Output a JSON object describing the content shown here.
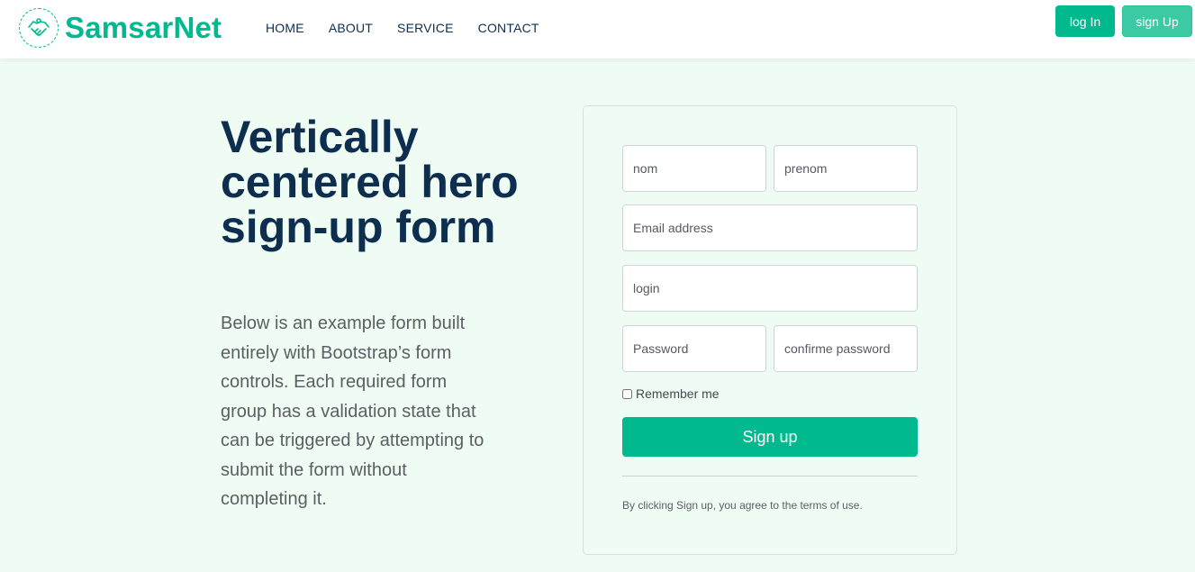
{
  "brand": {
    "name": "SamsarNet",
    "logo_icon": "handshake-icon",
    "accent_color": "#00b98e"
  },
  "nav": {
    "links": [
      {
        "label": "HOME"
      },
      {
        "label": "ABOUT"
      },
      {
        "label": "SERVICE"
      },
      {
        "label": "CONTACT"
      }
    ],
    "login_label": "log In",
    "signup_label": "sign Up"
  },
  "hero": {
    "title": "Vertically centered hero sign-up form",
    "description": "Below is an example form built entirely with Bootstrap’s form controls. Each required form group has a validation state that can be triggered by attempting to submit the form without completing it."
  },
  "form": {
    "nom_placeholder": "nom",
    "prenom_placeholder": "prenom",
    "email_placeholder": "Email address",
    "login_placeholder": "login",
    "password_placeholder": "Password",
    "confirm_password_placeholder": "confirme password",
    "remember_label": "Remember me",
    "remember_checked": false,
    "submit_label": "Sign up",
    "terms_text": "By clicking Sign up, you agree to the terms of use."
  }
}
